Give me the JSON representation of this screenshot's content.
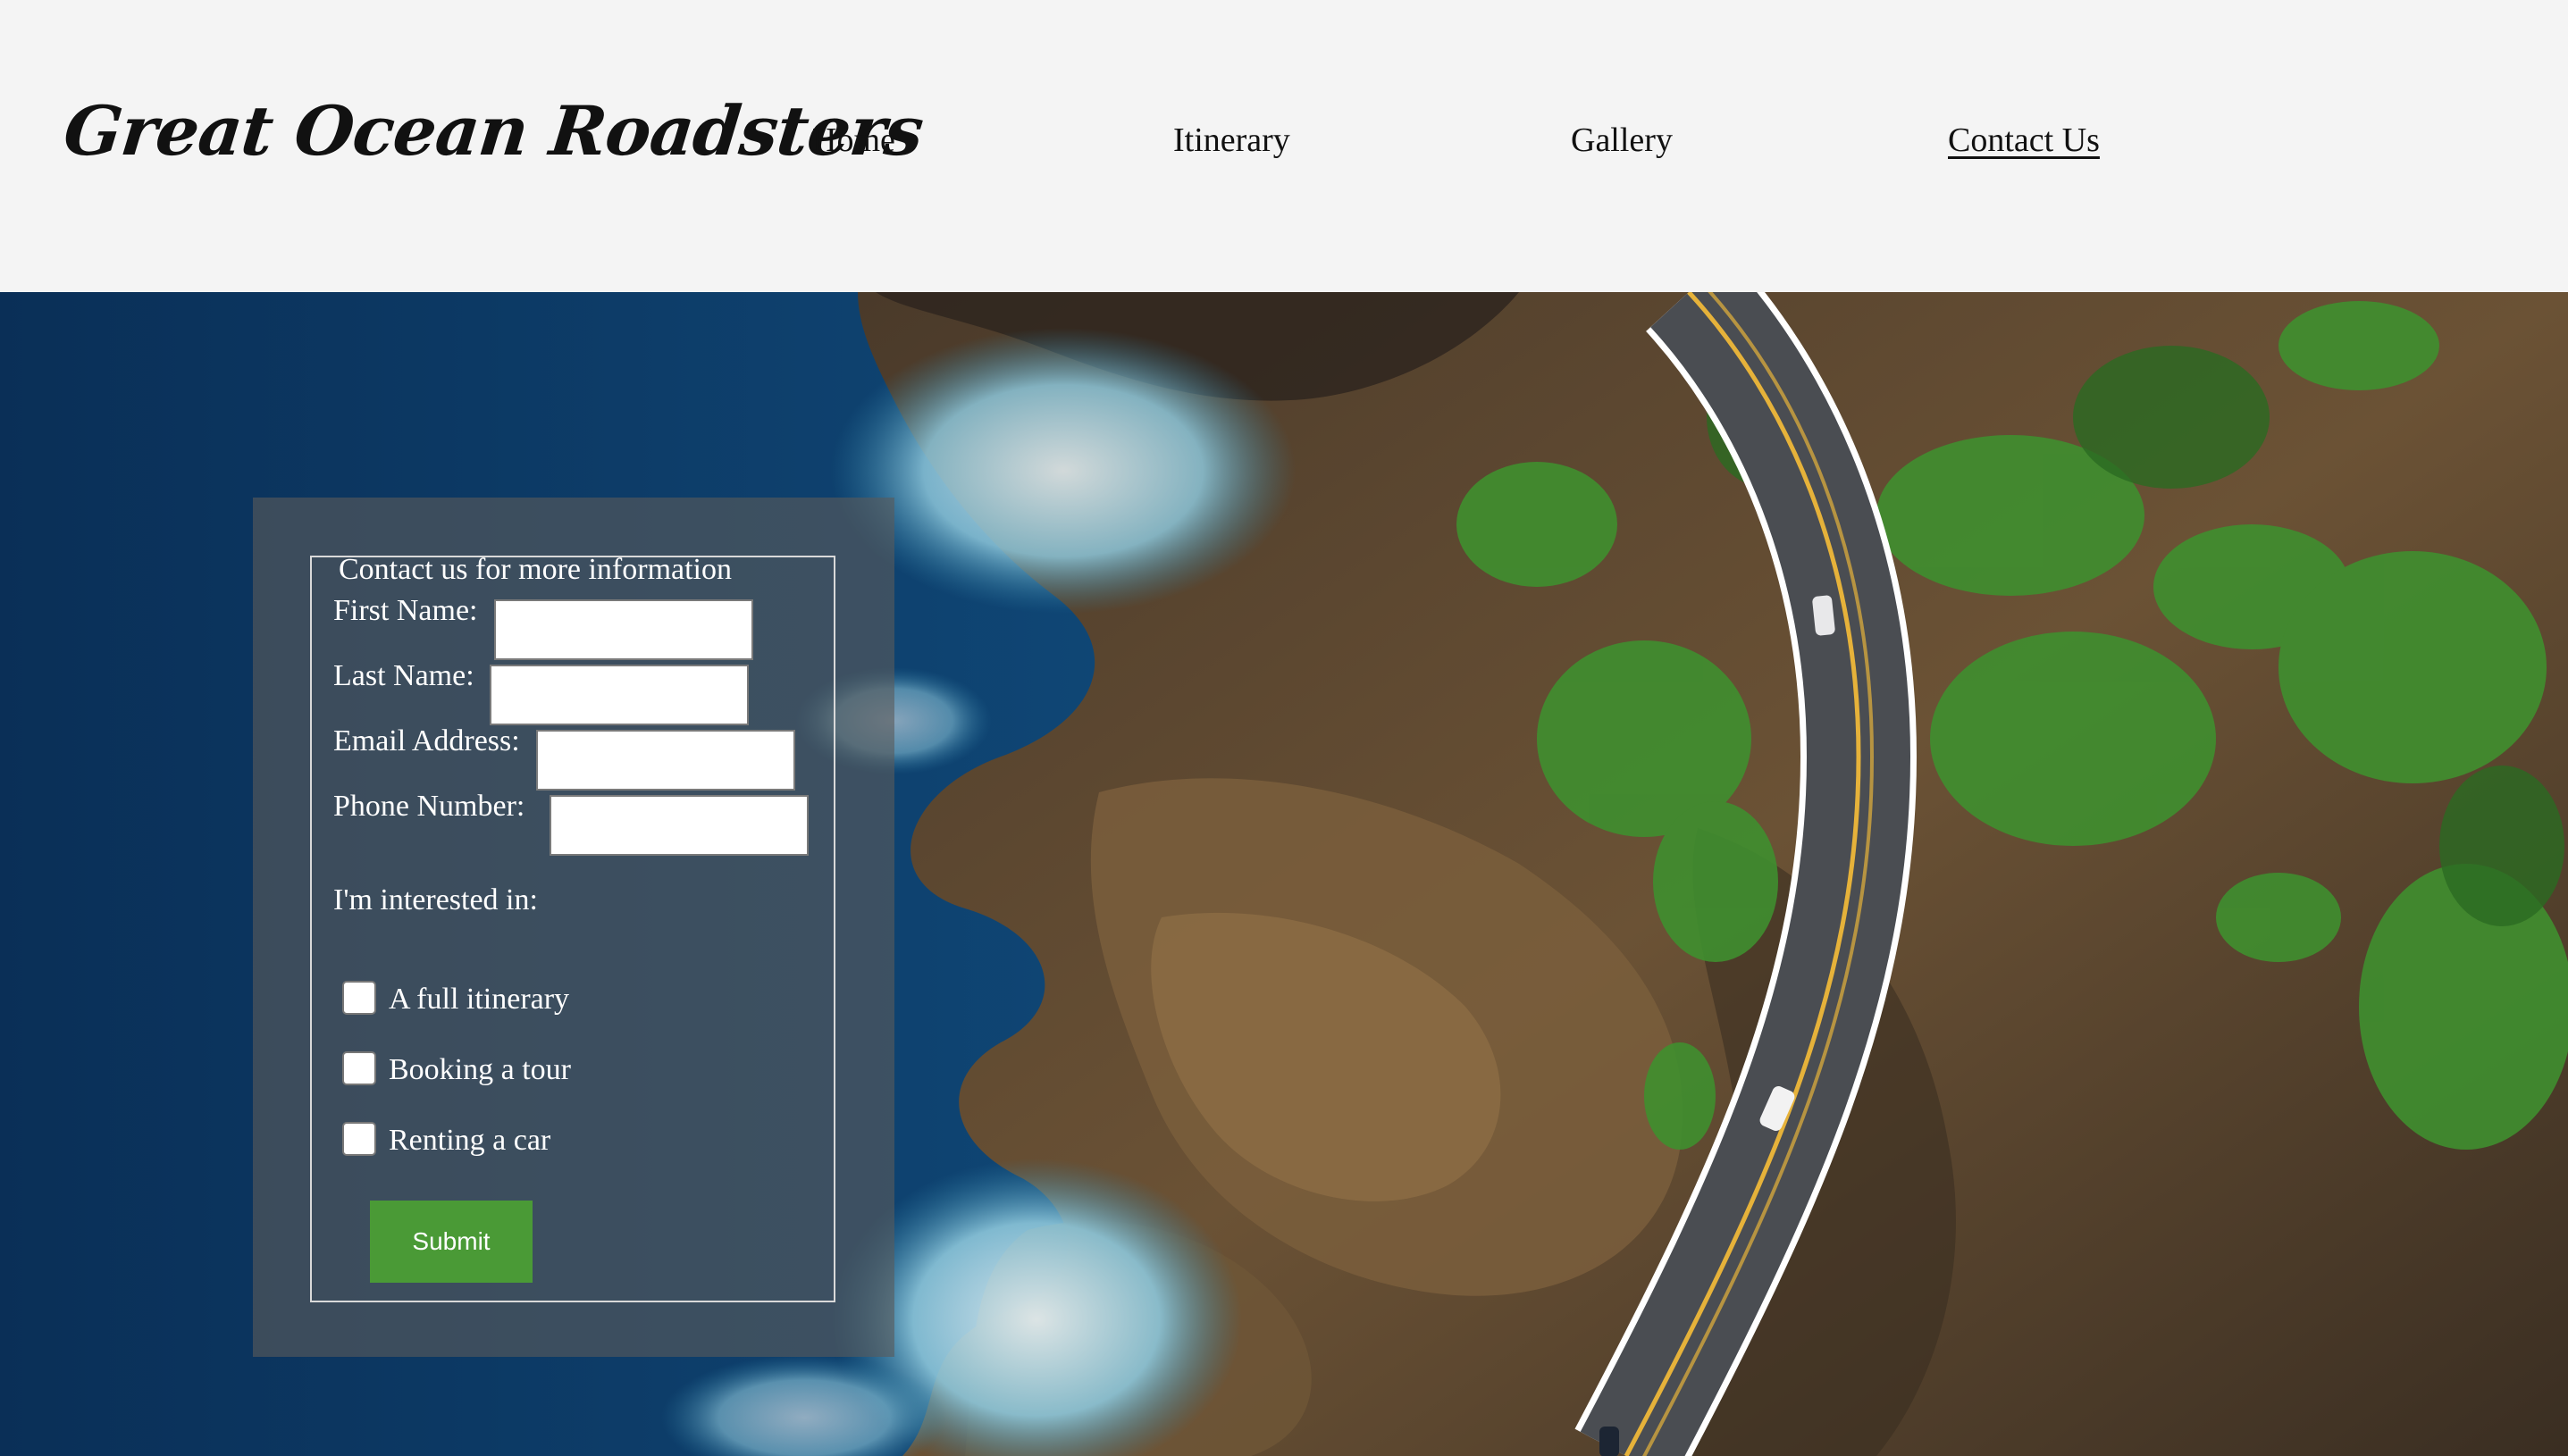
{
  "site": {
    "logo": "Great Ocean Roadsters"
  },
  "nav": {
    "items": [
      {
        "label": "Home"
      },
      {
        "label": "Itinerary"
      },
      {
        "label": "Gallery"
      },
      {
        "label": "Contact Us"
      }
    ],
    "active": "Contact Us"
  },
  "form": {
    "legend": "Contact us for more information",
    "first_name_label": "First Name:",
    "last_name_label": "Last Name:",
    "email_label": "Email Address:",
    "phone_label": "Phone Number:",
    "first_name_value": "",
    "last_name_value": "",
    "email_value": "",
    "phone_value": "",
    "interest_heading": "I'm interested in:",
    "options": [
      {
        "label": "A full itinerary",
        "checked": false
      },
      {
        "label": "Booking a tour",
        "checked": false
      },
      {
        "label": "Renting a car",
        "checked": false
      }
    ],
    "submit_label": "Submit"
  },
  "colors": {
    "header_bg": "#f4f4f4",
    "submit_bg": "#4a9a36",
    "panel_bg": "rgba(90,90,90,0.62)",
    "ocean": "#0d3a66",
    "road": "#4a4d52",
    "road_center_line": "#e6b23a"
  }
}
